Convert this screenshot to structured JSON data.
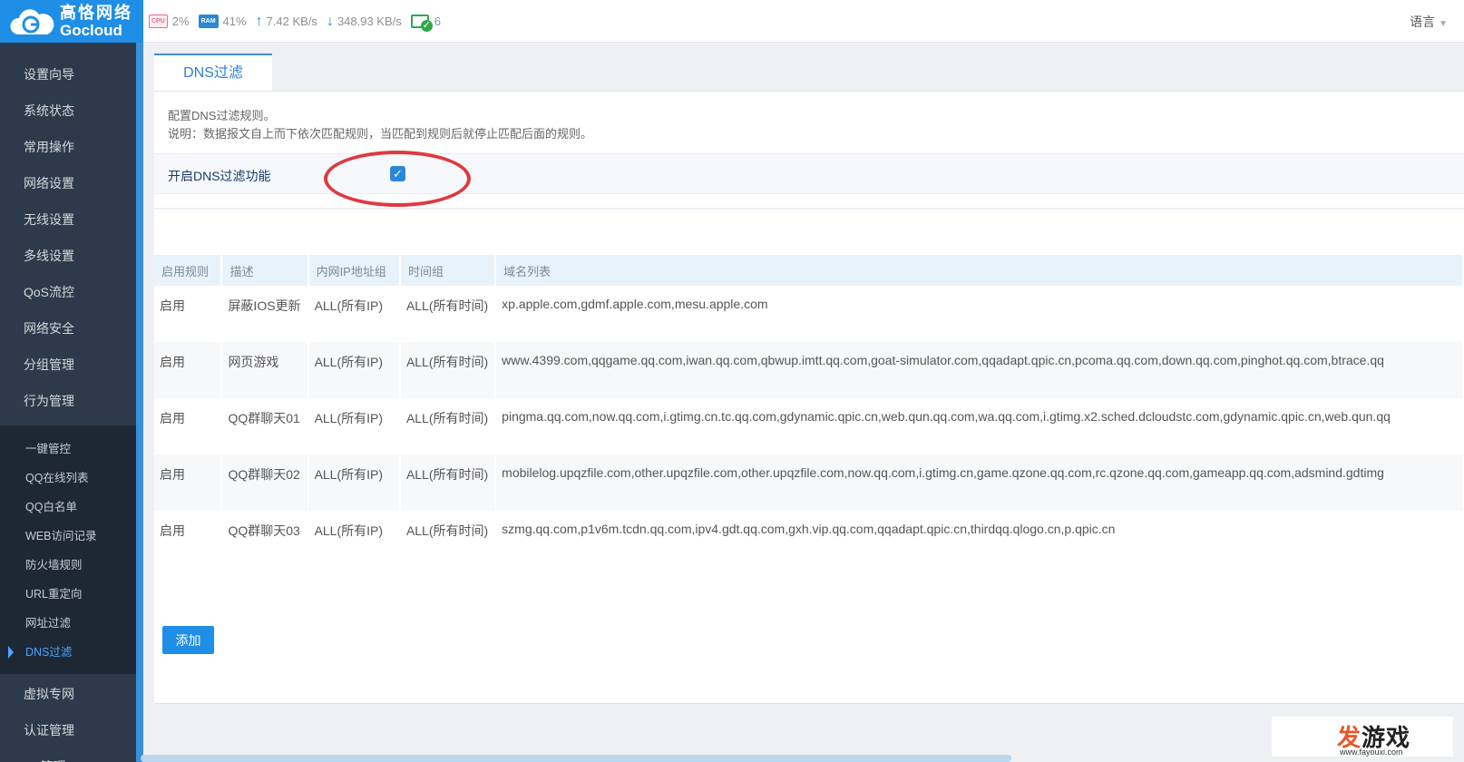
{
  "brand": {
    "name_cn": "高恪网络",
    "name_en": "Gocloud"
  },
  "status": {
    "cpu_chip": "CPU",
    "cpu": "2%",
    "ram_chip": "RAM",
    "ram": "41%",
    "upload": "7.42 KB/s",
    "download": "348.93 KB/s",
    "online_count": "6",
    "language": "语言"
  },
  "sidebar": {
    "items": [
      "设置向导",
      "系统状态",
      "常用操作",
      "网络设置",
      "无线设置",
      "多线设置",
      "QoS流控",
      "网络安全",
      "分组管理",
      "行为管理"
    ],
    "sub_items": [
      "一键管控",
      "QQ在线列表",
      "QQ白名单",
      "WEB访问记录",
      "防火墙规则",
      "URL重定向",
      "网址过滤",
      "DNS过滤"
    ],
    "items_after": [
      "虚拟专网",
      "认证管理",
      "AP管理"
    ]
  },
  "tab": {
    "label": "DNS过滤"
  },
  "description": {
    "line1": "配置DNS过滤规则。",
    "line2": "说明：数据报文自上而下依次匹配规则，当匹配到规则后就停止匹配后面的规则。"
  },
  "toggle": {
    "label": "开启DNS过滤功能",
    "checked": true
  },
  "table": {
    "headers": [
      "启用规则",
      "描述",
      "内网IP地址组",
      "时间组",
      "域名列表"
    ],
    "rows": [
      [
        "启用",
        "屏蔽IOS更新",
        "ALL(所有IP)",
        "ALL(所有时间)",
        "xp.apple.com,gdmf.apple.com,mesu.apple.com"
      ],
      [
        "启用",
        "网页游戏",
        "ALL(所有IP)",
        "ALL(所有时间)",
        "www.4399.com,qqgame.qq.com,iwan.qq.com,qbwup.imtt.qq.com,goat-simulator.com,qqadapt.qpic.cn,pcoma.qq.com,down.qq.com,pinghot.qq.com,btrace.qq"
      ],
      [
        "启用",
        "QQ群聊天01",
        "ALL(所有IP)",
        "ALL(所有时间)",
        "pingma.qq.com,now.qq.com,i.gtimg.cn.tc.qq.com,gdynamic.qpic.cn,web.qun.qq.com,wa.qq.com,i.gtimg.x2.sched.dcloudstc.com,gdynamic.qpic.cn,web.qun.qq"
      ],
      [
        "启用",
        "QQ群聊天02",
        "ALL(所有IP)",
        "ALL(所有时间)",
        "mobilelog.upqzfile.com,other.upqzfile.com,other.upqzfile.com,now.qq.com,i.gtimg.cn,game.qzone.qq.com,rc.qzone.qq.com,gameapp.qq.com,adsmind.gdtimg"
      ],
      [
        "启用",
        "QQ群聊天03",
        "ALL(所有IP)",
        "ALL(所有时间)",
        "szmg.qq.com,p1v6m.tcdn.qq.com,ipv4.gdt.qq.com,gxh.vip.qq.com,qqadapt.qpic.cn,thirdqq.qlogo.cn,p.qpic.cn"
      ]
    ]
  },
  "add_button": "添加",
  "watermark": {
    "fa": "发",
    "rest": "游戏",
    "url": "www.fayouxi.com"
  },
  "colors": {
    "brand_blue": "#1f8ee6",
    "sidebar_bg": "#2d3a4b",
    "highlight_red": "#e0393e",
    "active_blue": "#4aa8ff"
  }
}
